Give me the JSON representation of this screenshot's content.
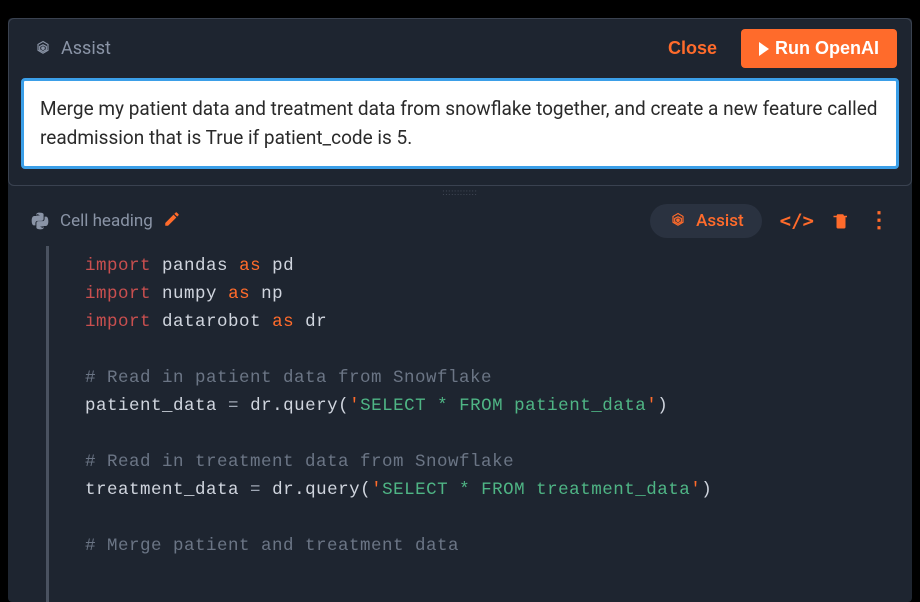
{
  "assist_panel": {
    "title": "Assist",
    "close_label": "Close",
    "run_label": "Run OpenAI",
    "prompt_text": "Merge my patient data and treatment data from snowflake together, and create a new feature called readmission that is True if patient_code is 5."
  },
  "cell_toolbar": {
    "heading_label": "Cell heading",
    "assist_pill_label": "Assist",
    "code_toggle_label": "</>"
  },
  "code": {
    "lines": [
      {
        "type": "import",
        "kw1": "import",
        "module": "pandas",
        "kw2": "as",
        "alias": "pd"
      },
      {
        "type": "import",
        "kw1": "import",
        "module": "numpy",
        "kw2": "as",
        "alias": "np"
      },
      {
        "type": "import",
        "kw1": "import",
        "module": "datarobot",
        "kw2": "as",
        "alias": "dr"
      },
      {
        "type": "blank"
      },
      {
        "type": "comment",
        "text": "# Read in patient data from Snowflake"
      },
      {
        "type": "assign",
        "lhs": "patient_data",
        "op": "=",
        "obj": "dr",
        "method": "query",
        "str": "SELECT * FROM patient_data"
      },
      {
        "type": "blank"
      },
      {
        "type": "comment",
        "text": "# Read in treatment data from Snowflake"
      },
      {
        "type": "assign",
        "lhs": "treatment_data",
        "op": "=",
        "obj": "dr",
        "method": "query",
        "str": "SELECT * FROM treatment_data"
      },
      {
        "type": "blank"
      },
      {
        "type": "comment",
        "text": "# Merge patient and treatment data"
      }
    ]
  },
  "resize_handle_chars": "::::::::::::"
}
